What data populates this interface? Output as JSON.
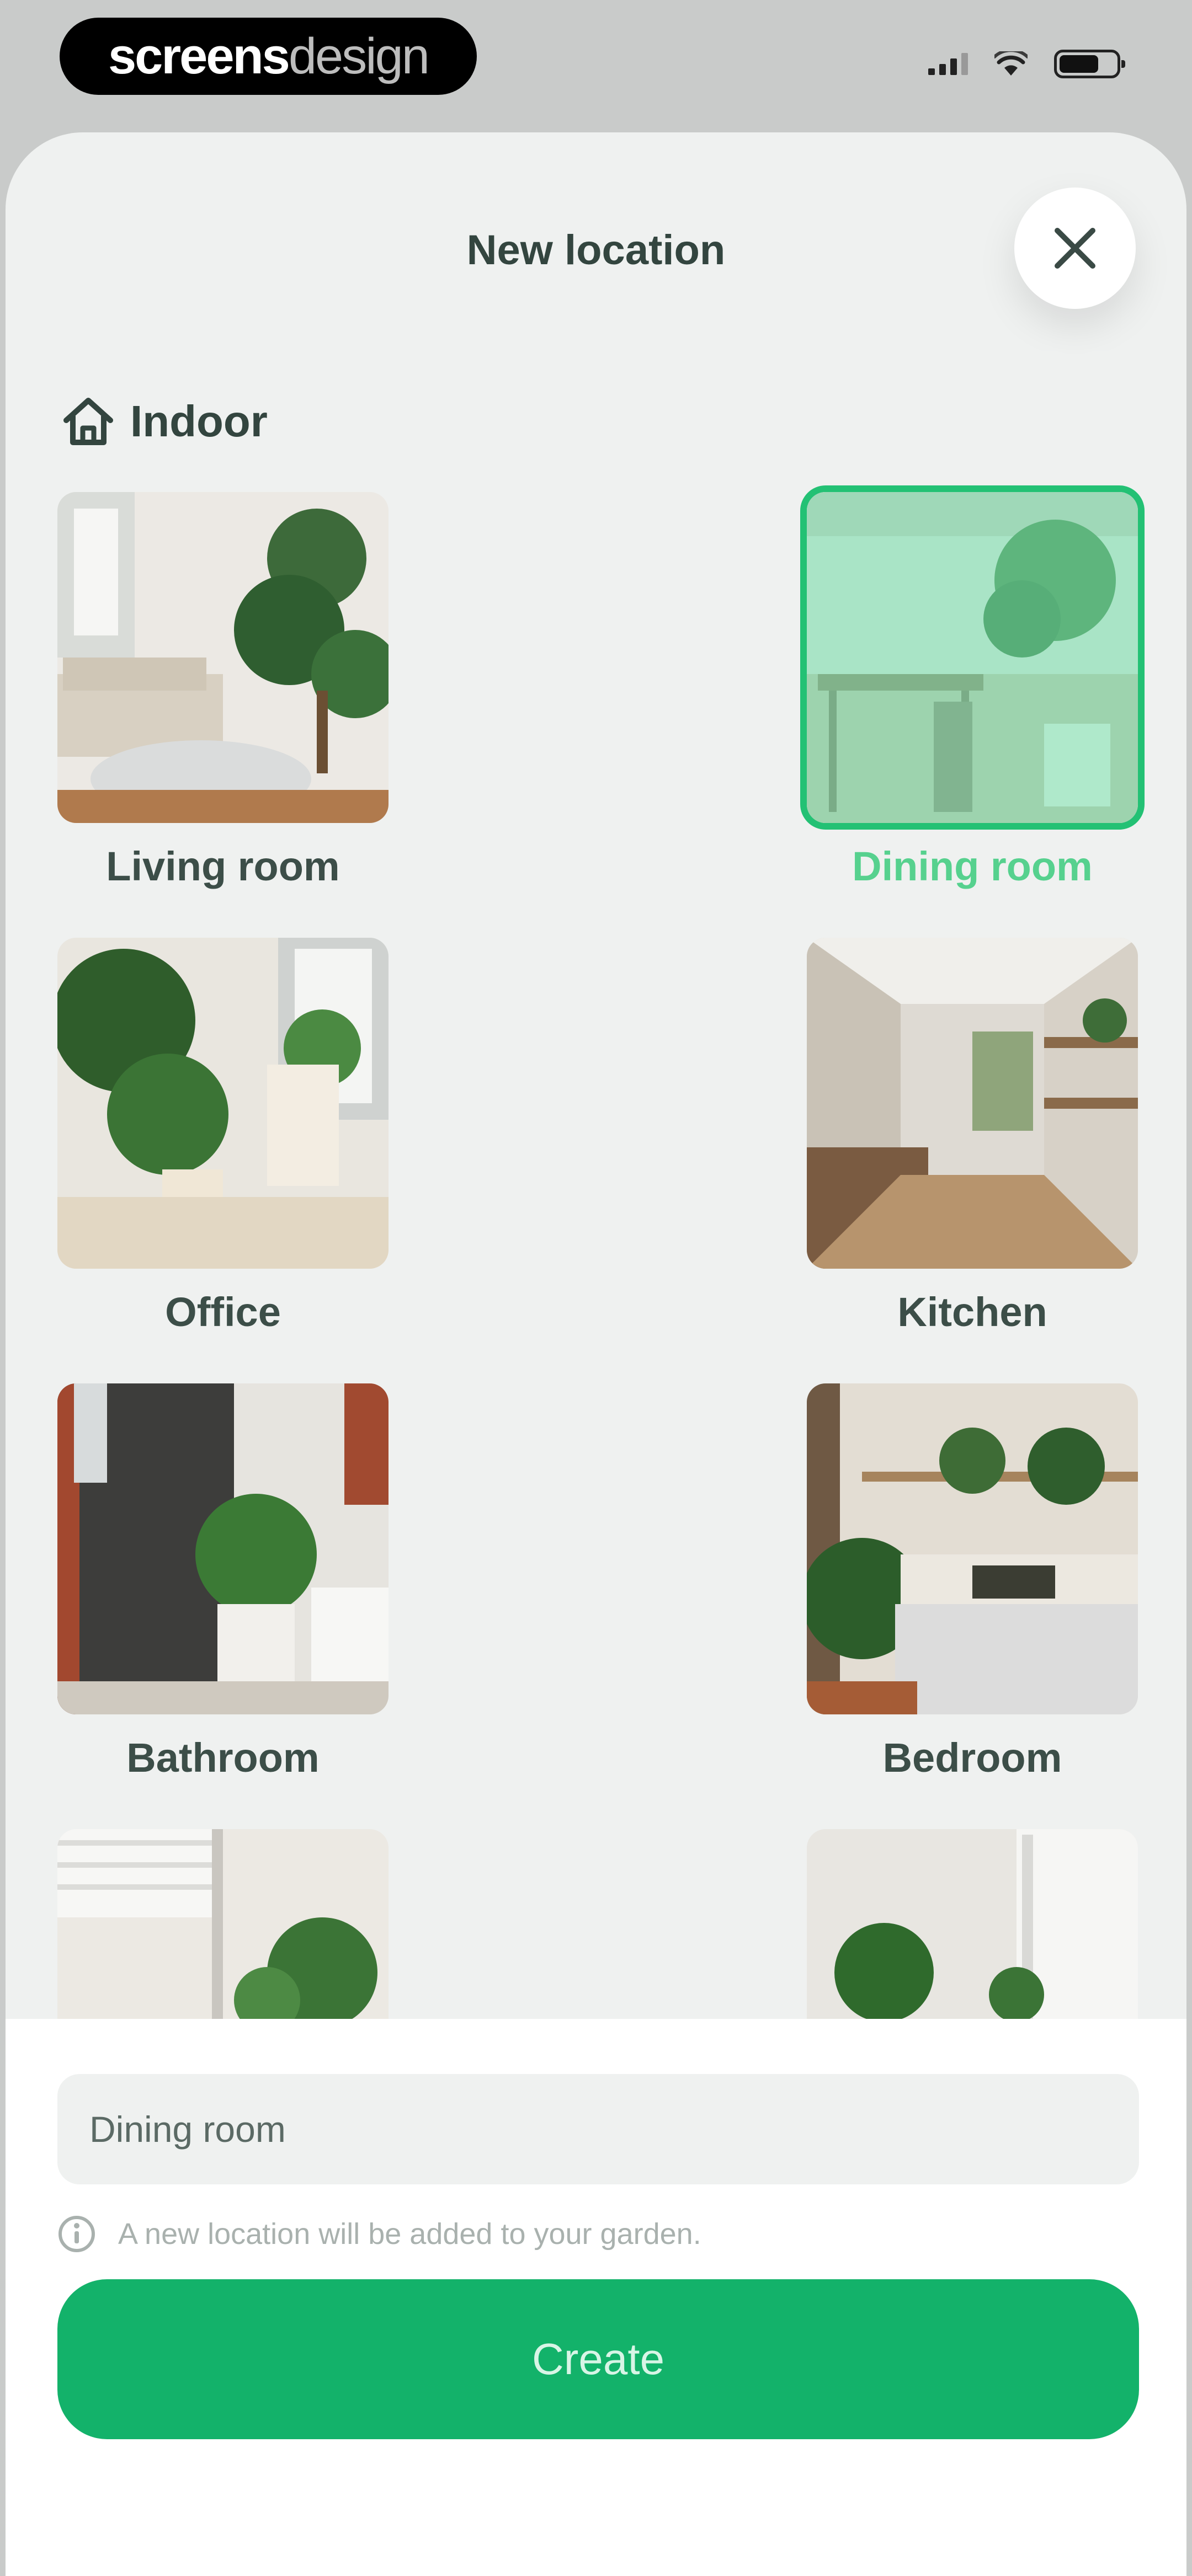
{
  "status_bar": {
    "brand_bold": "screens",
    "brand_light": "design"
  },
  "sheet": {
    "title": "New location",
    "close_label": "Close"
  },
  "section": {
    "title": "Indoor",
    "icon": "home-icon"
  },
  "locations": [
    {
      "label": "Living room",
      "selected": false
    },
    {
      "label": "Dining room",
      "selected": true
    },
    {
      "label": "Office",
      "selected": false
    },
    {
      "label": "Kitchen",
      "selected": false
    },
    {
      "label": "Bathroom",
      "selected": false
    },
    {
      "label": "Bedroom",
      "selected": false
    },
    {
      "label": "",
      "selected": false
    },
    {
      "label": "",
      "selected": false
    }
  ],
  "form": {
    "name_value": "Dining room",
    "hint": "A new location will be added to your garden.",
    "create_label": "Create"
  },
  "colors": {
    "accent": "#13b26a",
    "selected_label": "#56d18e",
    "sheet_bg": "#eff1f0"
  }
}
